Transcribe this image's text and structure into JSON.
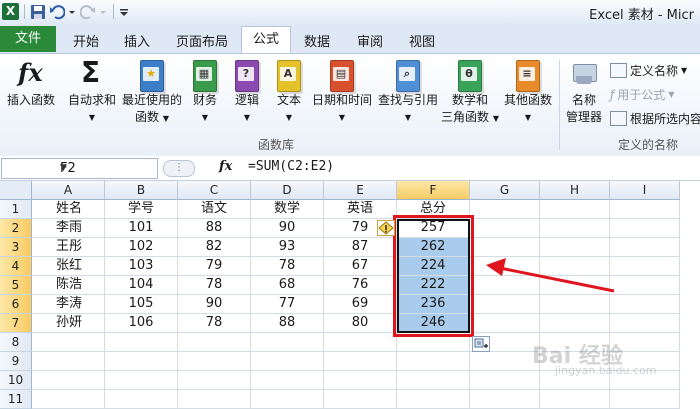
{
  "window": {
    "title": "Excel 素材 - Micr"
  },
  "tabs": {
    "file": "文件",
    "items": [
      "开始",
      "插入",
      "页面布局",
      "公式",
      "数据",
      "审阅",
      "视图"
    ],
    "active": "公式"
  },
  "ribbon": {
    "insert_function": "插入函数",
    "autosum": "自动求和",
    "recent": [
      "最近使用的",
      "函数"
    ],
    "financial": "财务",
    "logical": "逻辑",
    "text": "文本",
    "datetime": "日期和时间",
    "lookup": "查找与引用",
    "math": [
      "数学和",
      "三角函数"
    ],
    "other": "其他函数",
    "name_manager": [
      "名称",
      "管理器"
    ],
    "define_name": "定义名称",
    "use_in_formula": "用于公式",
    "create_from_selection": "根据所选内容",
    "group_library": "函数库",
    "group_names": "定义的名称",
    "fx_glyph": "fx",
    "sigma_glyph": "Σ",
    "theta_glyph": "θ",
    "a_glyph": "A",
    "q_glyph": "?"
  },
  "formula_bar": {
    "name_box": "F2",
    "fx": "fx",
    "formula": "=SUM(C2:E2)"
  },
  "grid": {
    "columns": [
      "A",
      "B",
      "C",
      "D",
      "E",
      "F",
      "G",
      "H",
      "I"
    ],
    "rows": [
      "1",
      "2",
      "3",
      "4",
      "5",
      "6",
      "7",
      "8",
      "9",
      "10",
      "11"
    ],
    "header_row": [
      "姓名",
      "学号",
      "语文",
      "数学",
      "英语",
      "总分"
    ],
    "data": [
      [
        "李雨",
        "101",
        "88",
        "90",
        "79",
        "257"
      ],
      [
        "王彤",
        "102",
        "82",
        "93",
        "87",
        "262"
      ],
      [
        "张红",
        "103",
        "79",
        "78",
        "67",
        "224"
      ],
      [
        "陈浩",
        "104",
        "78",
        "68",
        "76",
        "222"
      ],
      [
        "李涛",
        "105",
        "90",
        "77",
        "69",
        "236"
      ],
      [
        "孙妍",
        "106",
        "78",
        "88",
        "80",
        "246"
      ]
    ],
    "active_cell": "F2"
  },
  "watermark": {
    "main": "Bai 经验",
    "sub": "jingyan.baidu.com"
  },
  "colors": {
    "file_tab": "#2a8a3a",
    "selection": "#a9ccec",
    "highlight": "#e0161e"
  }
}
